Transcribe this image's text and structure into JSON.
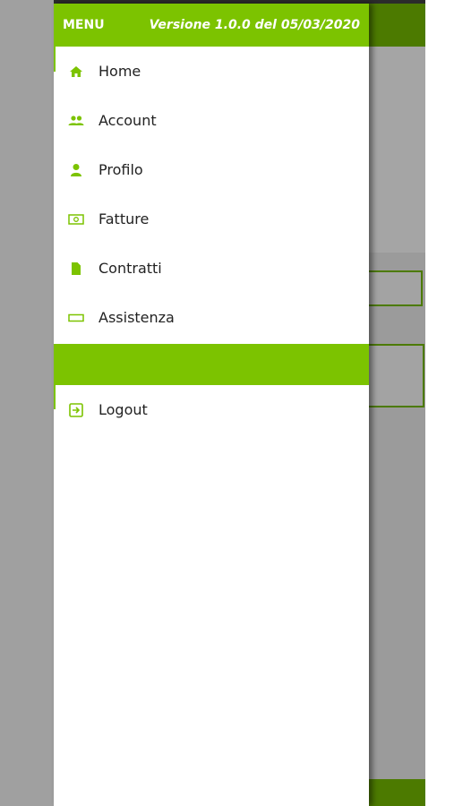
{
  "colors": {
    "accent": "#7cc300",
    "dark_accent": "#4c7a00"
  },
  "drawer": {
    "menu_title": "MENU",
    "version": "Versione 1.0.0 del 05/03/2020",
    "items": [
      {
        "label": "Home",
        "icon": "home-icon"
      },
      {
        "label": "Account",
        "icon": "people-icon"
      },
      {
        "label": "Profilo",
        "icon": "person-icon"
      },
      {
        "label": "Fatture",
        "icon": "money-icon"
      },
      {
        "label": "Contratti",
        "icon": "document-icon"
      },
      {
        "label": "Assistenza",
        "icon": "rectangle-icon"
      }
    ],
    "logout_label": "Logout"
  }
}
